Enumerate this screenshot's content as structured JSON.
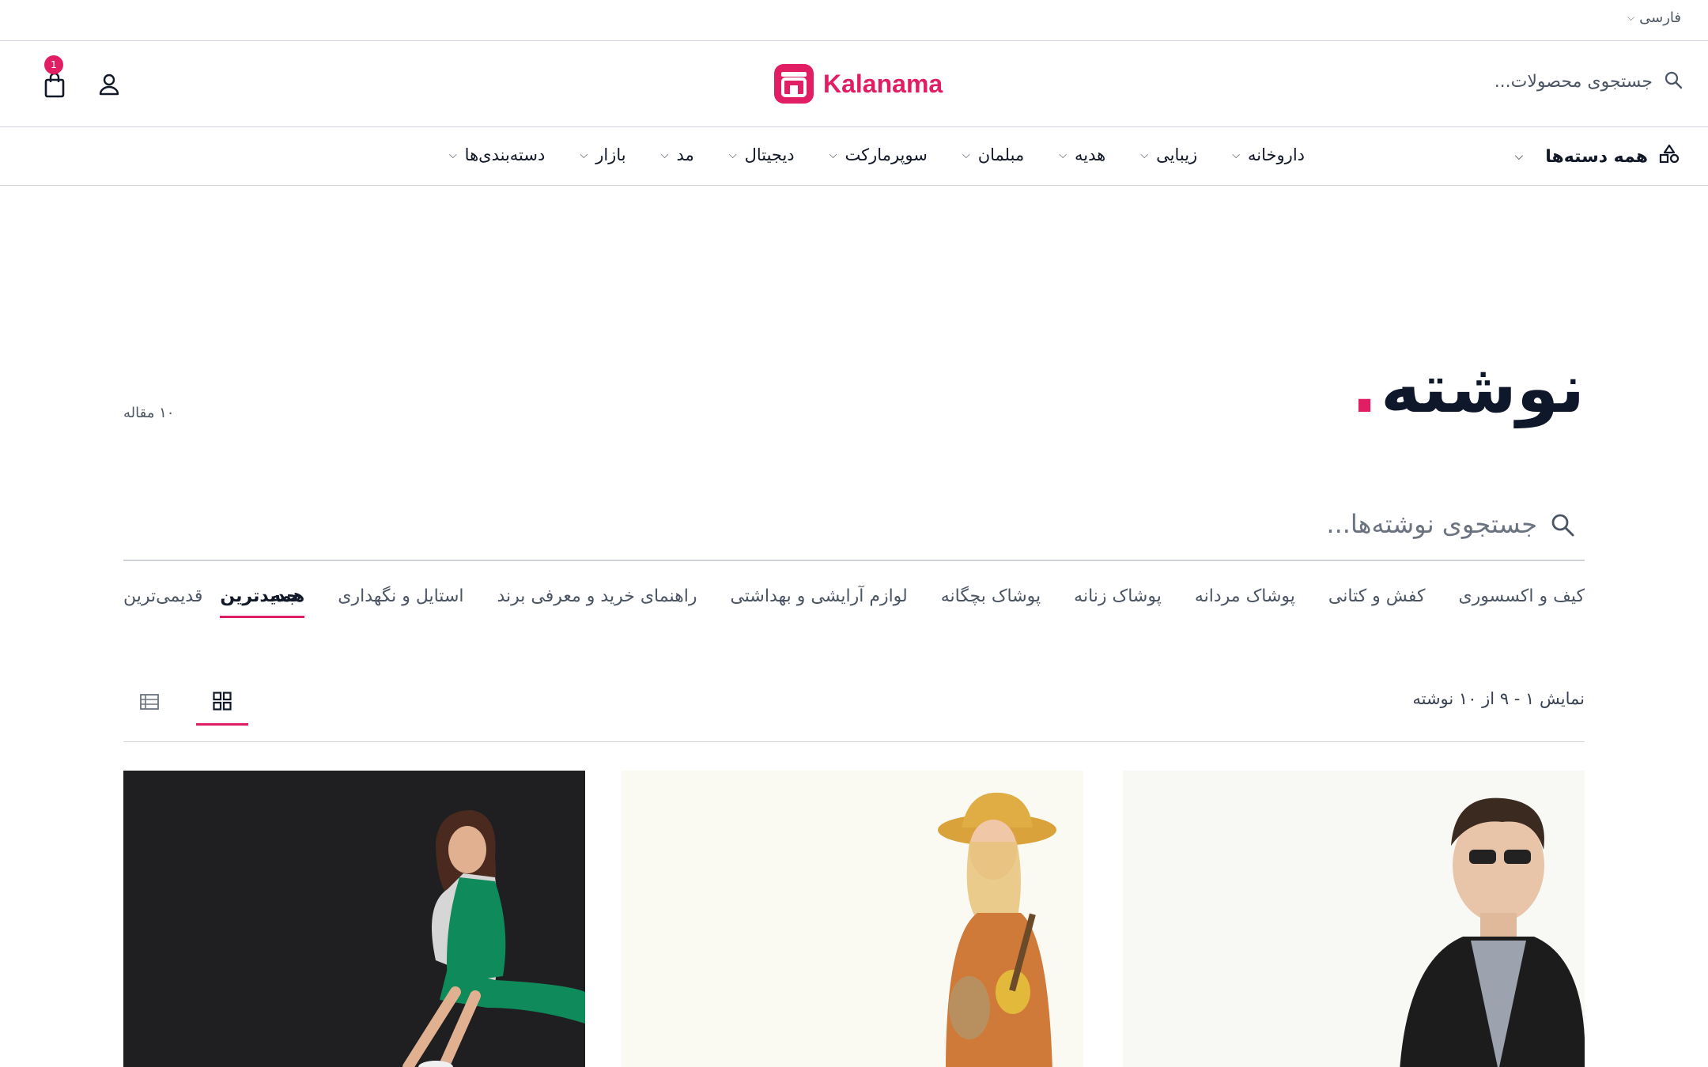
{
  "language": {
    "label": "فارسی"
  },
  "header": {
    "search_placeholder": "جستجوی محصولات...",
    "logo_text": "Kalanama",
    "cart_count": "1",
    "brand_color": "#e11d63"
  },
  "nav": {
    "all_categories": "همه دسته‌ها",
    "items": [
      "دسته‌بندی‌ها",
      "بازار",
      "مد",
      "دیجیتال",
      "سوپرمارکت",
      "مبلمان",
      "هدیه",
      "زیبایی",
      "داروخانه"
    ]
  },
  "page": {
    "title": "نوشته",
    "title_dot": ".",
    "article_count": "۱۰ مقاله",
    "search_placeholder": "جستجوی نوشته‌ها..."
  },
  "filters": {
    "tabs": [
      "همه",
      "استایل و نگهداری",
      "راهنمای خرید و معرفی برند",
      "لوازم آرایشی و بهداشتی",
      "پوشاک بچگانه",
      "پوشاک زنانه",
      "پوشاک مردانه",
      "کفش و کتانی",
      "کیف و اکسسوری"
    ],
    "sort": [
      "جدیدترین",
      "قدیمی‌ترین"
    ]
  },
  "results": {
    "summary": "نمایش ۱ - ۹ از ۱۰ نوشته"
  },
  "icons": {
    "search": "search-icon",
    "cart": "shopping-bag-icon",
    "user": "user-icon",
    "grid": "grid-view-icon",
    "list": "list-view-icon",
    "categories": "shapes-icon"
  }
}
